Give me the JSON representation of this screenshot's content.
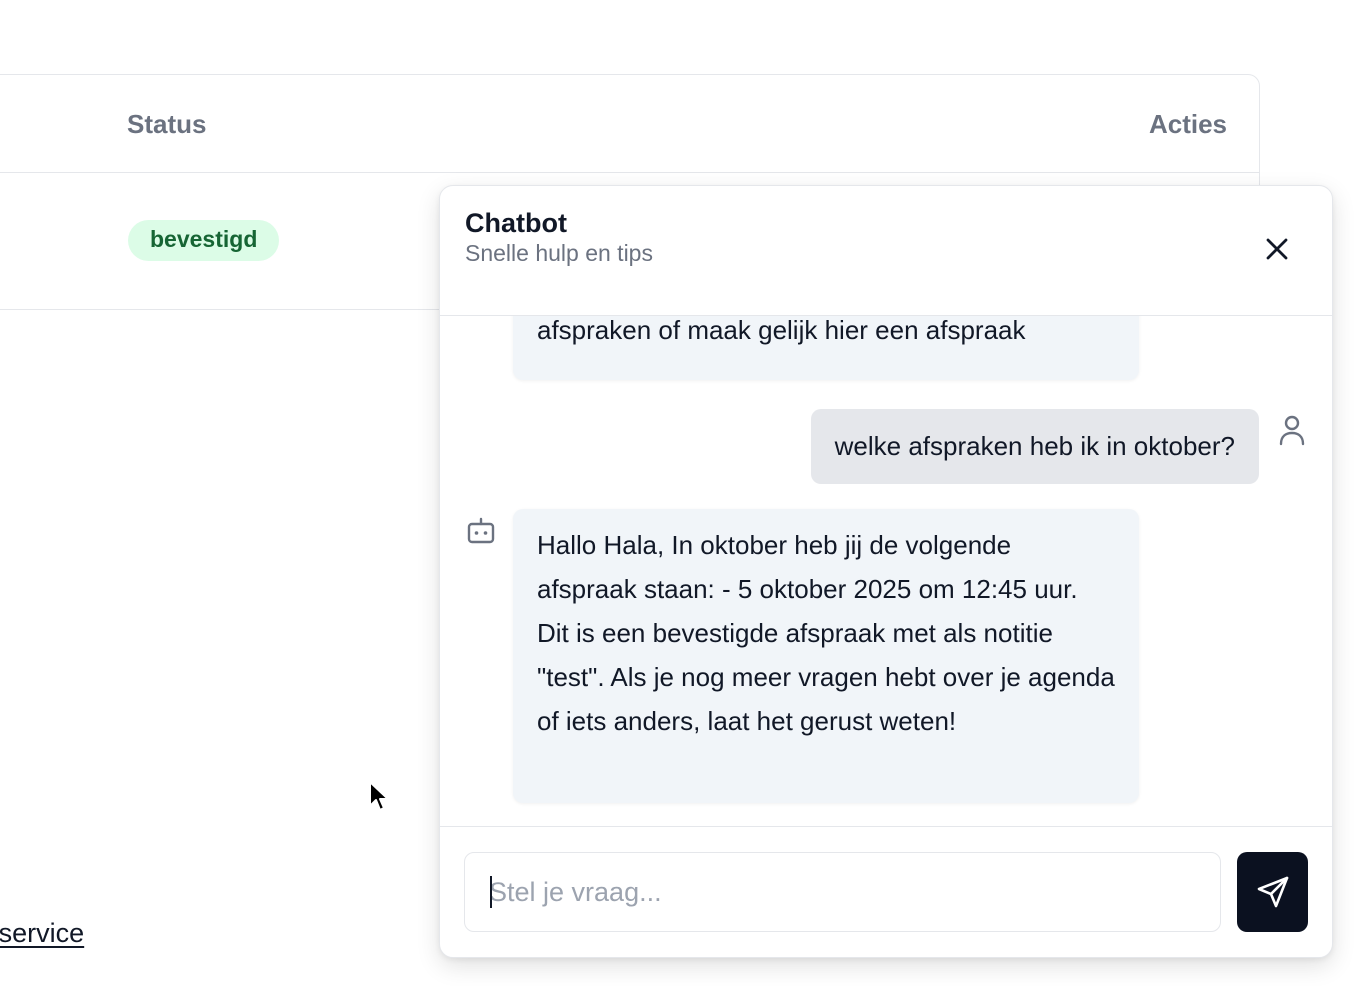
{
  "table": {
    "headers": {
      "status": "Status",
      "actions": "Acties"
    },
    "rows": [
      {
        "status_badge": "bevestigd"
      }
    ]
  },
  "footer": {
    "link_text": "' service"
  },
  "chat": {
    "title": "Chatbot",
    "subtitle": "Snelle hulp en tips",
    "close_icon": "close-icon",
    "messages": [
      {
        "role": "bot",
        "text": "afspraken of maak gelijk hier een afspraak"
      },
      {
        "role": "user",
        "text": "welke afspraken heb ik in oktober?"
      },
      {
        "role": "bot",
        "text": "Hallo Hala, In oktober heb jij de volgende afspraak staan: - 5 oktober 2025 om 12:45 uur. Dit is een bevestigde afspraak met als notitie \"test\". Als je nog meer vragen hebt over je agenda of iets anders, laat het gerust weten!"
      }
    ],
    "input": {
      "placeholder": "Stel je vraag...",
      "value": ""
    },
    "send_icon": "send-icon",
    "colors": {
      "send_button": "#0b1120",
      "bot_bubble": "#f1f5f9",
      "user_bubble": "#e5e7eb",
      "badge_bg": "#dcfce7",
      "badge_text": "#166534"
    }
  }
}
